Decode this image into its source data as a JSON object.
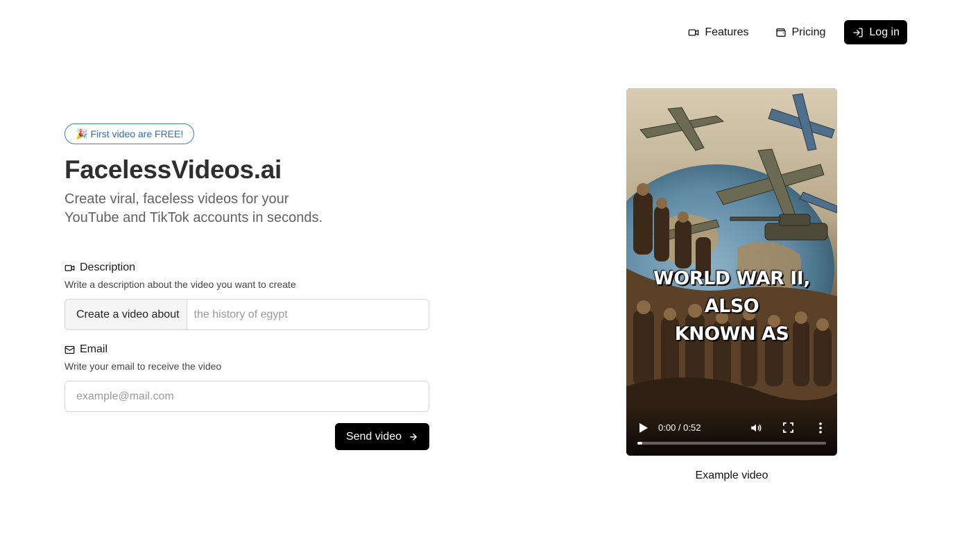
{
  "nav": {
    "features_label": "Features",
    "pricing_label": "Pricing",
    "login_label": "Log in"
  },
  "hero": {
    "badge_emoji": "🎉",
    "badge_text": "First video are FREE!",
    "title": "FacelessVideos.ai",
    "subtitle": "Create viral, faceless videos for your YouTube and TikTok accounts in seconds."
  },
  "description_field": {
    "label": "Description",
    "help": "Write a description about the video you want to create",
    "prefix": "Create a video about",
    "placeholder": "the history of egypt",
    "value": ""
  },
  "email_field": {
    "label": "Email",
    "help": "Write your email to receive the video",
    "placeholder": "example@mail.com",
    "value": ""
  },
  "send_button_label": "Send video",
  "video": {
    "caption_line1": "WORLD WAR II, ALSO",
    "caption_line2": "KNOWN AS",
    "time": "0:00 / 0:52",
    "progress": 0,
    "label": "Example video"
  },
  "colors": {
    "accent_badge": "#3b82c4",
    "button_bg": "#000000"
  },
  "icons": {
    "features": "video-camera-icon",
    "pricing": "wallet-icon",
    "login": "log-in-icon",
    "description": "video-camera-icon",
    "email": "mail-icon",
    "send": "arrow-right-icon"
  }
}
